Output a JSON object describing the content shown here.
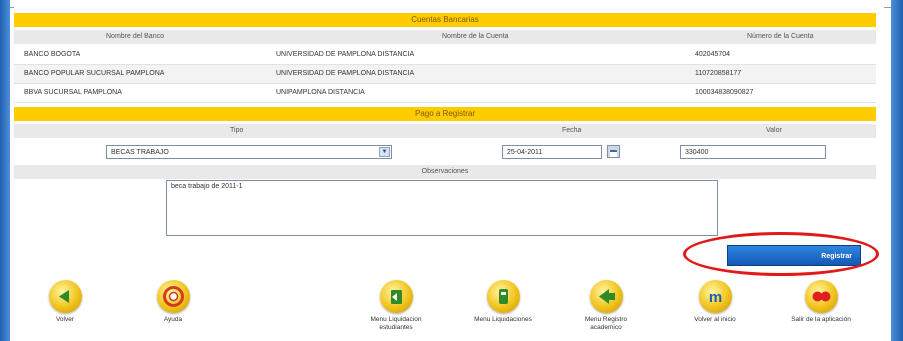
{
  "table_title": "Cuentas Bancarias",
  "columns": {
    "bank": "Nombre del Banco",
    "account_name": "Nombre de la Cuenta",
    "account_number": "Número de la Cuenta"
  },
  "accounts": [
    {
      "bank": "BANCO BOGOTA",
      "name": "UNIVERSIDAD DE PAMPLONA DISTANCIA",
      "number": "402045704"
    },
    {
      "bank": "BANCO POPULAR SUCURSAL PAMPLONA",
      "name": "UNIVERSIDAD DE PAMPLONA DISTANCIA",
      "number": "110720858177"
    },
    {
      "bank": "BBVA SUCURSAL PAMPLONA",
      "name": "UNIPAMPLONA DISTANCIA",
      "number": "100034838090827"
    }
  ],
  "payment_section": "Pago a Registrar",
  "payment_columns": {
    "type": "Tipo",
    "date": "Fecha",
    "value": "Valor"
  },
  "payment": {
    "type": "BECAS TRABAJO",
    "date": "25-04-2011",
    "value": "330400"
  },
  "observations_label": "Observaciones",
  "observations_text": "beca trabajo de 2011-1",
  "register_button": "Registrar",
  "nav": [
    {
      "label": "Volver",
      "icon": "back-arrow-icon"
    },
    {
      "label": "Ayuda",
      "icon": "help-icon"
    },
    {
      "label": "Menu Liquidacion estudiantes",
      "icon": "students-menu-icon"
    },
    {
      "label": "Menu Liquidaciones",
      "icon": "liquidations-menu-icon"
    },
    {
      "label": "Menu Registro academico",
      "icon": "academic-registry-icon"
    },
    {
      "label": "Volver al inicio",
      "icon": "home-icon"
    },
    {
      "label": "Salir de la aplicación",
      "icon": "exit-icon"
    }
  ]
}
